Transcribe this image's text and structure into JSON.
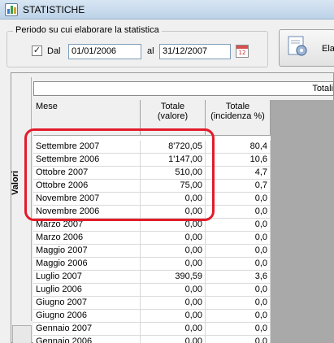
{
  "window": {
    "title": "STATISTICHE"
  },
  "period": {
    "group_label": "Periodo su cui elaborare la statistica",
    "checkbox_checked": true,
    "checkbox_mark": "✓",
    "dal_label": "Dal",
    "dal_value": "01/01/2006",
    "al_label": "al",
    "al_value": "31/12/2007",
    "calendar_icon_text": "12"
  },
  "elabora_button": {
    "label": "Ela"
  },
  "side_tab": {
    "label": "Valori"
  },
  "totali_bar": {
    "label": "Totali"
  },
  "grid": {
    "headers": {
      "mese": "Mese",
      "valore": "Totale\n(valore)",
      "incidenza": "Totale\n(incidenza %)"
    },
    "rows": [
      {
        "mese": "Settembre 2007",
        "valore": "8'720,05",
        "incidenza": "80,4"
      },
      {
        "mese": "Settembre 2006",
        "valore": "1'147,00",
        "incidenza": "10,6"
      },
      {
        "mese": "Ottobre 2007",
        "valore": "510,00",
        "incidenza": "4,7"
      },
      {
        "mese": "Ottobre 2006",
        "valore": "75,00",
        "incidenza": "0,7"
      },
      {
        "mese": "Novembre 2007",
        "valore": "0,00",
        "incidenza": "0,0"
      },
      {
        "mese": "Novembre 2006",
        "valore": "0,00",
        "incidenza": "0,0"
      },
      {
        "mese": "Marzo 2007",
        "valore": "0,00",
        "incidenza": "0,0"
      },
      {
        "mese": "Marzo 2006",
        "valore": "0,00",
        "incidenza": "0,0"
      },
      {
        "mese": "Maggio 2007",
        "valore": "0,00",
        "incidenza": "0,0"
      },
      {
        "mese": "Maggio 2006",
        "valore": "0,00",
        "incidenza": "0,0"
      },
      {
        "mese": "Luglio 2007",
        "valore": "390,59",
        "incidenza": "3,6"
      },
      {
        "mese": "Luglio 2006",
        "valore": "0,00",
        "incidenza": "0,0"
      },
      {
        "mese": "Giugno 2007",
        "valore": "0,00",
        "incidenza": "0,0"
      },
      {
        "mese": "Giugno 2006",
        "valore": "0,00",
        "incidenza": "0,0"
      },
      {
        "mese": "Gennaio 2007",
        "valore": "0,00",
        "incidenza": "0,0"
      },
      {
        "mese": "Gennaio 2006",
        "valore": "0,00",
        "incidenza": "0,0"
      }
    ]
  },
  "colors": {
    "highlight": "#e31b2a",
    "empty_area": "#a9a9a9"
  }
}
